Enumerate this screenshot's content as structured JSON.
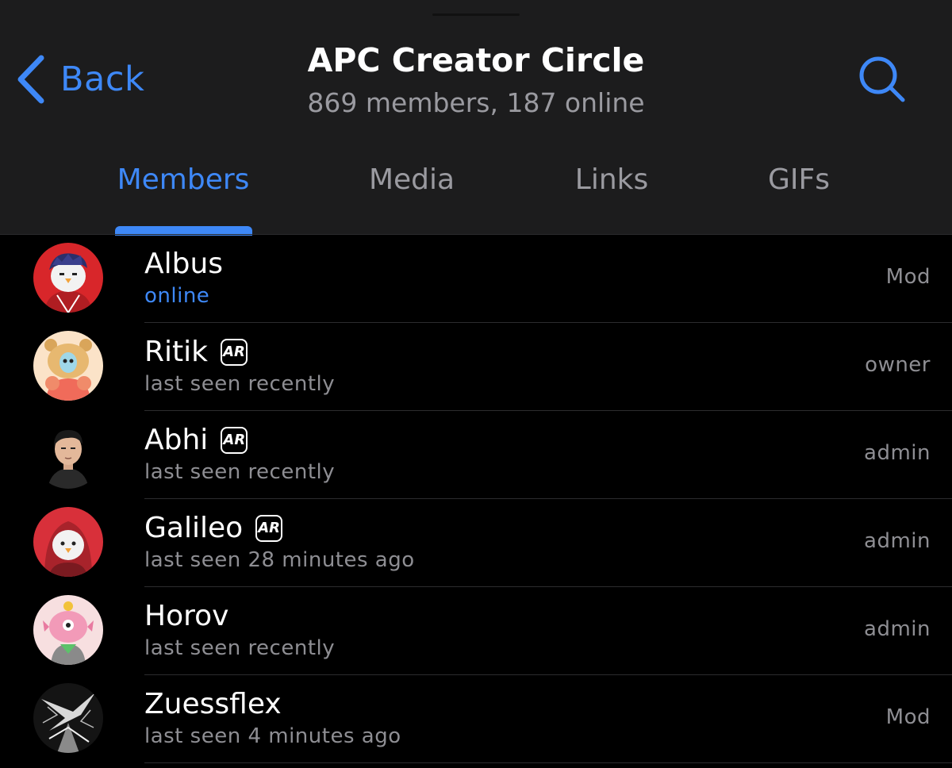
{
  "header": {
    "back_label": "Back",
    "title": "APC Creator Circle",
    "subtitle": "869 members, 187 online",
    "accent_color": "#3e88f7"
  },
  "tabs": [
    {
      "label": "Members",
      "active": true
    },
    {
      "label": "Media",
      "active": false
    },
    {
      "label": "Links",
      "active": false
    },
    {
      "label": "GIFs",
      "active": false
    }
  ],
  "members": [
    {
      "name": "Albus",
      "status": "online",
      "role": "Mod",
      "badge": false
    },
    {
      "name": "Ritik",
      "status": "last seen recently",
      "role": "owner",
      "badge": true
    },
    {
      "name": "Abhi",
      "status": "last seen recently",
      "role": "admin",
      "badge": true
    },
    {
      "name": "Galileo",
      "status": "last seen 28 minutes ago",
      "role": "admin",
      "badge": true
    },
    {
      "name": "Horov",
      "status": "last seen recently",
      "role": "admin",
      "badge": false
    },
    {
      "name": "Zuessflex",
      "status": "last seen 4 minutes ago",
      "role": "Mod",
      "badge": false
    }
  ],
  "badge_text": "AR"
}
